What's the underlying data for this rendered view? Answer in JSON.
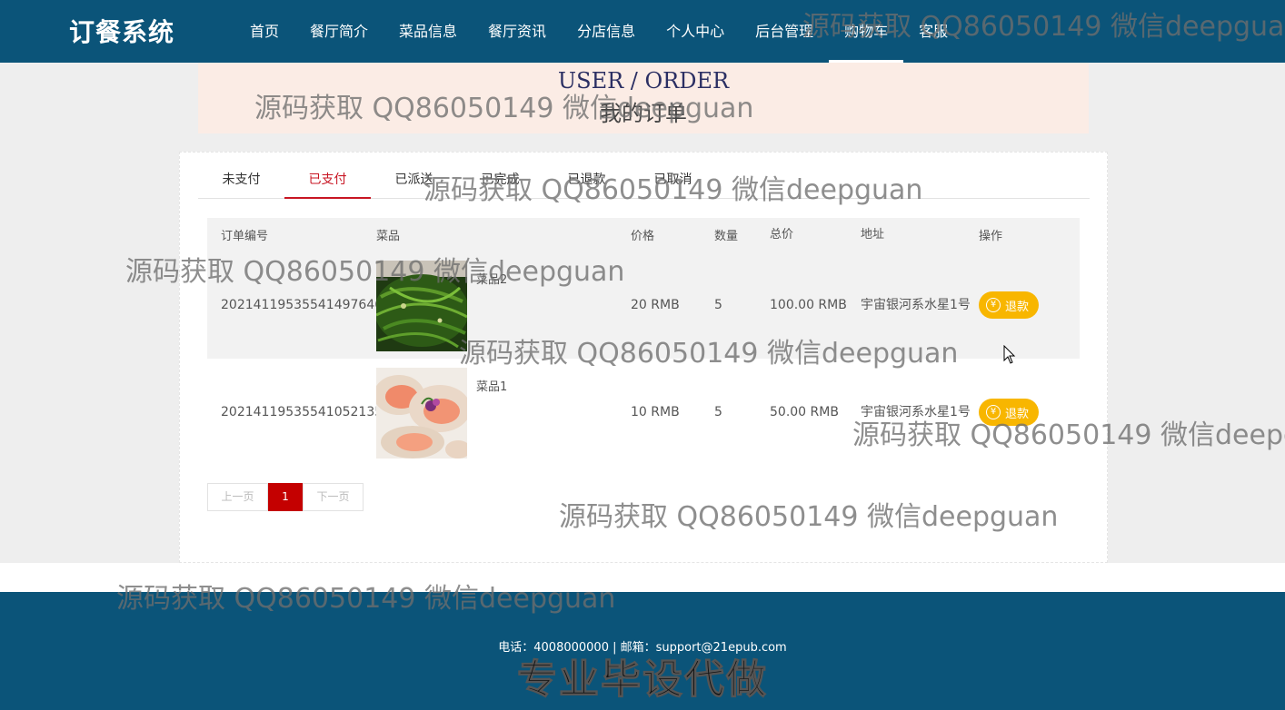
{
  "header": {
    "logo": "订餐系统",
    "nav": [
      "首页",
      "餐厅简介",
      "菜品信息",
      "餐厅资讯",
      "分店信息",
      "个人中心",
      "后台管理",
      "购物车",
      "客服"
    ],
    "active_nav": "购物车"
  },
  "banner": {
    "en": "USER / ORDER",
    "cn": "我的订单"
  },
  "tabs": [
    "未支付",
    "已支付",
    "已派送",
    "已完成",
    "已退款",
    "已取消"
  ],
  "active_tab": "已支付",
  "table": {
    "headers": {
      "order_no": "订单编号",
      "dish": "菜品",
      "price": "价格",
      "qty": "数量",
      "total": "总价",
      "address": "地址",
      "action": "操作"
    },
    "rows": [
      {
        "order_no": "20214119535541497646",
        "dish": "菜品2",
        "price": "20 RMB",
        "qty": "5",
        "total": "100.00 RMB",
        "address": "宇宙银河系水星1号",
        "action": "退款",
        "image": "green-vegetable-dish"
      },
      {
        "order_no": "20214119535541052135",
        "dish": "菜品1",
        "price": "10 RMB",
        "qty": "5",
        "total": "50.00 RMB",
        "address": "宇宙银河系水星1号",
        "action": "退款",
        "image": "seafood-scallop-dish"
      }
    ]
  },
  "pager": {
    "prev": "上一页",
    "current": "1",
    "next": "下一页"
  },
  "footer": {
    "contact": "电话：4008000000 | 邮箱：support@21epub.com",
    "slogan": "专业毕设代做"
  },
  "watermark": "源码获取 QQ86050149 微信deepguan",
  "colors": {
    "header_bg": "#0b5479",
    "accent_red": "#c81623",
    "refund_btn": "#f8b600",
    "banner_bg": "#fbece5"
  }
}
